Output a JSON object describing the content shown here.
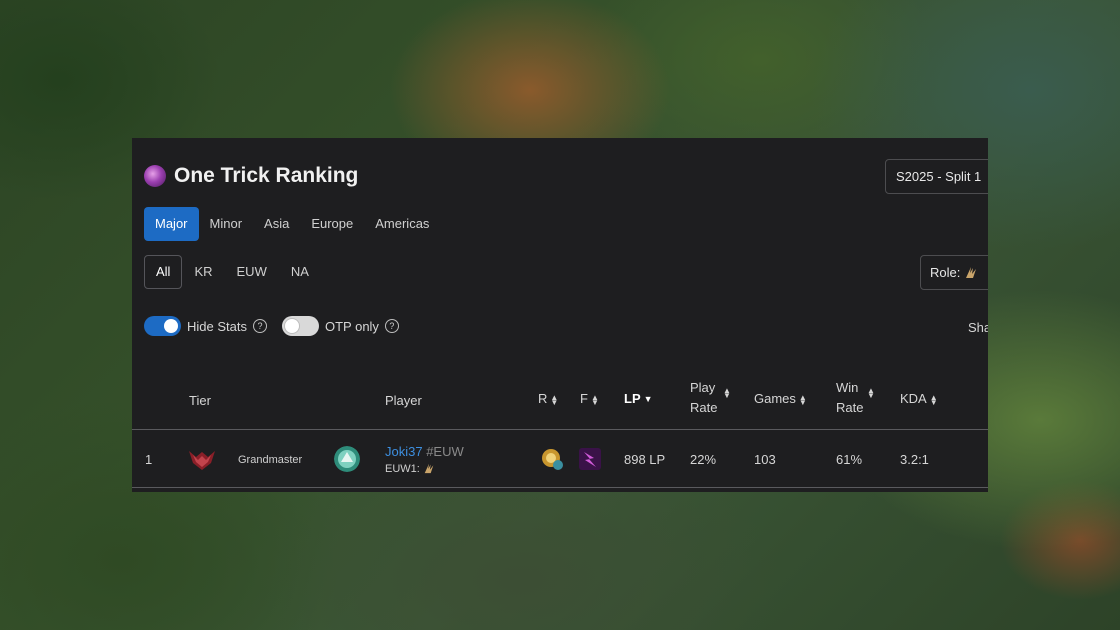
{
  "app": {
    "title": "One Trick Ranking",
    "season": "S2025 - Split 1"
  },
  "region_tabs": [
    "Major",
    "Minor",
    "Asia",
    "Europe",
    "Americas"
  ],
  "active_region_tab": "Major",
  "server_tabs": [
    "All",
    "KR",
    "EUW",
    "NA"
  ],
  "active_server_tab": "All",
  "role": {
    "label": "Role:",
    "icon": "role-mid-icon"
  },
  "toggles": {
    "hide_stats": {
      "label": "Hide Stats",
      "on": true
    },
    "otp_only": {
      "label": "OTP only",
      "on": false
    }
  },
  "share_label": "Sha",
  "table": {
    "headers": {
      "tier": "Tier",
      "player": "Player",
      "r": "R",
      "f": "F",
      "lp": "LP",
      "play_rate_1": "Play",
      "play_rate_2": "Rate",
      "games": "Games",
      "win_rate_1": "Win",
      "win_rate_2": "Rate",
      "kda": "KDA"
    },
    "rows": [
      {
        "rank": "1",
        "tier": "Grandmaster",
        "player_name": "Joki37",
        "player_tag": "#EUW",
        "player_sub": "EUW1:",
        "lp": "898 LP",
        "play_rate": "22%",
        "games": "103",
        "win_rate": "61%",
        "kda": "3.2:1"
      }
    ]
  },
  "colors": {
    "accent": "#1d6bc4",
    "panel_bg": "#1e1e20",
    "link": "#3d8fe0",
    "tier_emblem": "#b8323a"
  }
}
